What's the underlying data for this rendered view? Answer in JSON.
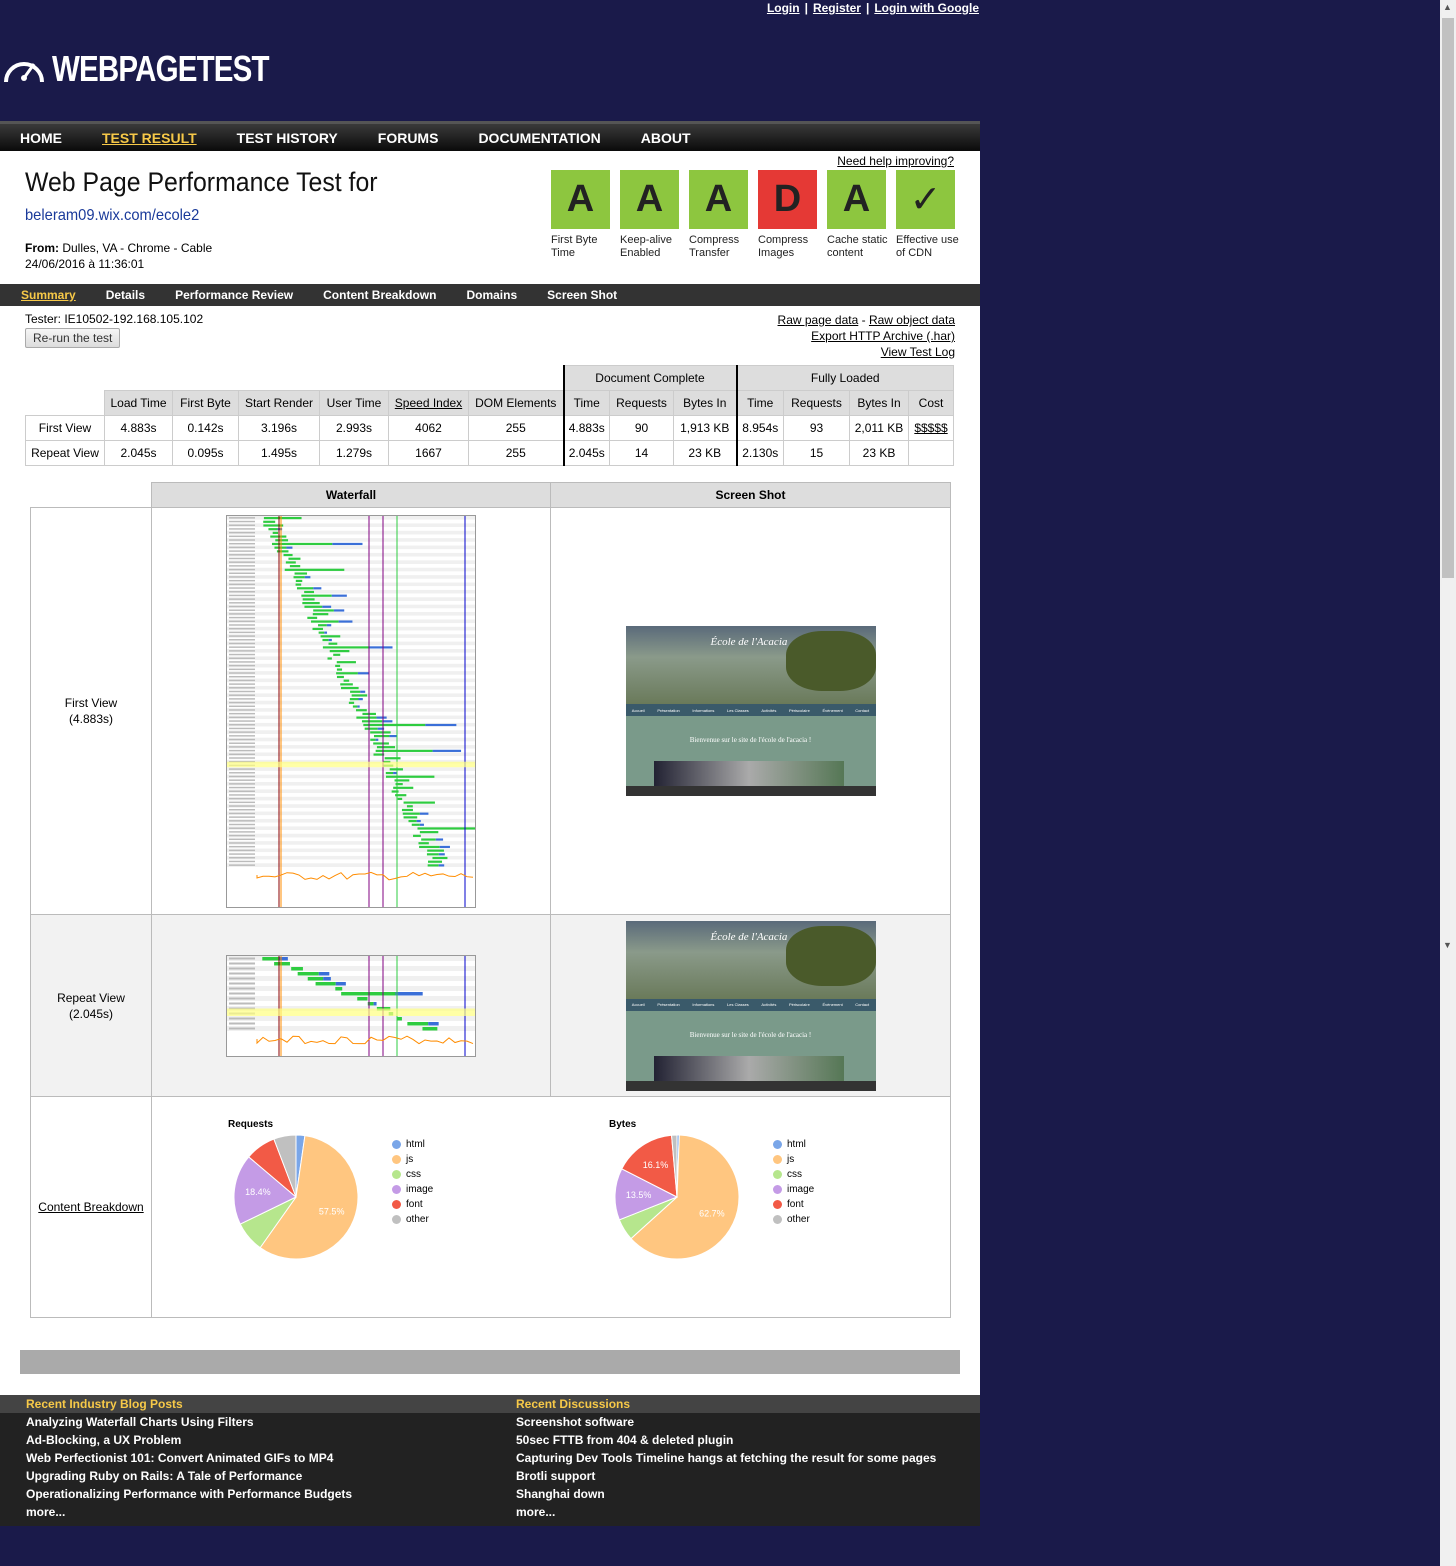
{
  "top_links": {
    "login": "Login",
    "register": "Register",
    "login_google": "Login with Google"
  },
  "logo": {
    "text": "WEBPAGETEST"
  },
  "nav": [
    "HOME",
    "TEST RESULT",
    "TEST HISTORY",
    "FORUMS",
    "DOCUMENTATION",
    "ABOUT"
  ],
  "nav_active": "TEST RESULT",
  "header": {
    "help_link": "Need help improving?",
    "title": "Web Page Performance Test for",
    "url": "beleram09.wix.com/ecole2",
    "from_label": "From:",
    "from_value": "Dulles, VA - Chrome - Cable",
    "date": "24/06/2016 à 11:36:01"
  },
  "grades": [
    {
      "grade": "A",
      "label": "First Byte Time",
      "status": "good"
    },
    {
      "grade": "A",
      "label": "Keep-alive Enabled",
      "status": "good"
    },
    {
      "grade": "A",
      "label": "Compress Transfer",
      "status": "good"
    },
    {
      "grade": "D",
      "label": "Compress Images",
      "status": "bad"
    },
    {
      "grade": "A",
      "label": "Cache static content",
      "status": "good"
    },
    {
      "grade": "✓",
      "label": "Effective use of CDN",
      "status": "good"
    }
  ],
  "colors": {
    "good": "#8dc63f",
    "bad": "#e53935",
    "accent": "#f7c948",
    "bg": "#1a1a4a"
  },
  "subnav": [
    "Summary",
    "Details",
    "Performance Review",
    "Content Breakdown",
    "Domains",
    "Screen Shot"
  ],
  "tester": "Tester: IE10502-192.168.105.102",
  "rerun_label": "Re-run the test",
  "right_links": {
    "raw_page": "Raw page data",
    "dash": " - ",
    "raw_object": "Raw object data",
    "export_har": "Export HTTP Archive (.har)",
    "view_log": "View Test Log"
  },
  "results": {
    "group_doc": "Document Complete",
    "group_full": "Fully Loaded",
    "headers": [
      "Load Time",
      "First Byte",
      "Start Render",
      "User Time",
      "Speed Index",
      "DOM Elements",
      "Time",
      "Requests",
      "Bytes In",
      "Time",
      "Requests",
      "Bytes In",
      "Cost"
    ],
    "rows": [
      {
        "label": "First View",
        "cells": [
          "4.883s",
          "0.142s",
          "3.196s",
          "2.993s",
          "4062",
          "255",
          "4.883s",
          "90",
          "1,913 KB",
          "8.954s",
          "93",
          "2,011 KB",
          "$$$$$"
        ]
      },
      {
        "label": "Repeat View",
        "cells": [
          "2.045s",
          "0.095s",
          "1.495s",
          "1.279s",
          "1667",
          "255",
          "2.045s",
          "14",
          "23 KB",
          "2.130s",
          "15",
          "23 KB",
          ""
        ]
      }
    ]
  },
  "waterfall_table": {
    "col_waterfall": "Waterfall",
    "col_screenshot": "Screen Shot",
    "first_view": "First View",
    "first_view_time": "(4.883s)",
    "repeat_view": "Repeat View",
    "repeat_view_time": "(2.045s)",
    "content_breakdown": "Content Breakdown"
  },
  "screenshot": {
    "site_title": "École de l'Acacia",
    "welcome": "Bienvenue sur le site de l'école de l'acacia !",
    "menu": [
      "Accueil",
      "Présentation",
      "Informations",
      "Les Classes",
      "Activités",
      "Périscolaire",
      "Évènement",
      "Contact"
    ]
  },
  "breakdown": {
    "legend": [
      "html",
      "js",
      "css",
      "image",
      "font",
      "other"
    ],
    "legend_colors": [
      "#7aa6e8",
      "#ffc680",
      "#b6e68d",
      "#c49be6",
      "#f25a46",
      "#c0c0c0"
    ],
    "requests": {
      "title": "Requests",
      "values": [
        2.3,
        57.5,
        8.0,
        18.4,
        8.0,
        5.8
      ],
      "labels": [
        "",
        "57.5%",
        "",
        "18.4%",
        "",
        ""
      ]
    },
    "bytes": {
      "title": "Bytes",
      "values": [
        0.6,
        62.7,
        5.7,
        13.5,
        16.1,
        1.4
      ],
      "labels": [
        "",
        "62.7%",
        "",
        "13.5%",
        "16.1%",
        ""
      ]
    }
  },
  "footer": {
    "blog_title": "Recent Industry Blog Posts",
    "blog_posts": [
      "Analyzing Waterfall Charts Using Filters",
      "Ad-Blocking, a UX Problem",
      "Web Perfectionist 101: Convert Animated GIFs to MP4",
      "Upgrading Ruby on Rails: A Tale of Performance",
      "Operationalizing Performance with Performance Budgets",
      "more..."
    ],
    "disc_title": "Recent Discussions",
    "discussions": [
      "Screenshot software",
      "50sec FTTB from 404 & deleted plugin",
      "Capturing Dev Tools Timeline hangs at fetching the result for some pages",
      "Brotli support",
      "Shanghai down",
      "more..."
    ]
  }
}
